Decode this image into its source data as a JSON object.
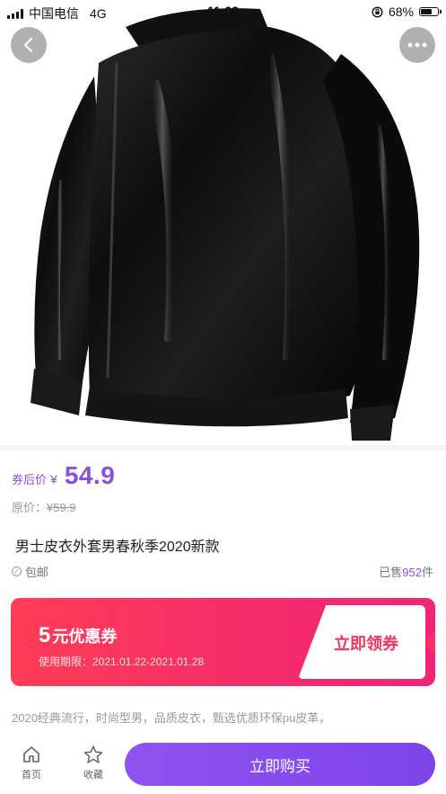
{
  "status_bar": {
    "carrier": "中国电信",
    "network": "4G",
    "time": "11:23",
    "battery": "68%",
    "battery_level": 0.68
  },
  "nav": {
    "back_icon": "chevron-left-icon",
    "more_icon": "ellipsis-icon"
  },
  "product": {
    "image_subject": "black leather jacket",
    "price_label": "券后价",
    "currency": "¥",
    "price": "54.9",
    "original_label": "原价：",
    "original_price": "¥59.9",
    "title": "男士皮衣外套男春秋季2020新款",
    "shipping": "包邮",
    "sold_prefix": "已售",
    "sold_count": "952",
    "sold_suffix": "件",
    "description": "2020经典流行，时尚型男，品质皮衣，甄选优质环保pu皮革，"
  },
  "coupon": {
    "amount": "5",
    "label": "元优惠券",
    "validity": "使用期限：2021.01.22-2021.01.28",
    "claim_label": "立即领券"
  },
  "bottom_bar": {
    "home_label": "首页",
    "favorite_label": "收藏",
    "buy_label": "立即购买"
  },
  "colors": {
    "accent_purple": "#8a4fe0",
    "coupon_red": "#ff3d55",
    "coupon_pink": "#f0257a"
  }
}
